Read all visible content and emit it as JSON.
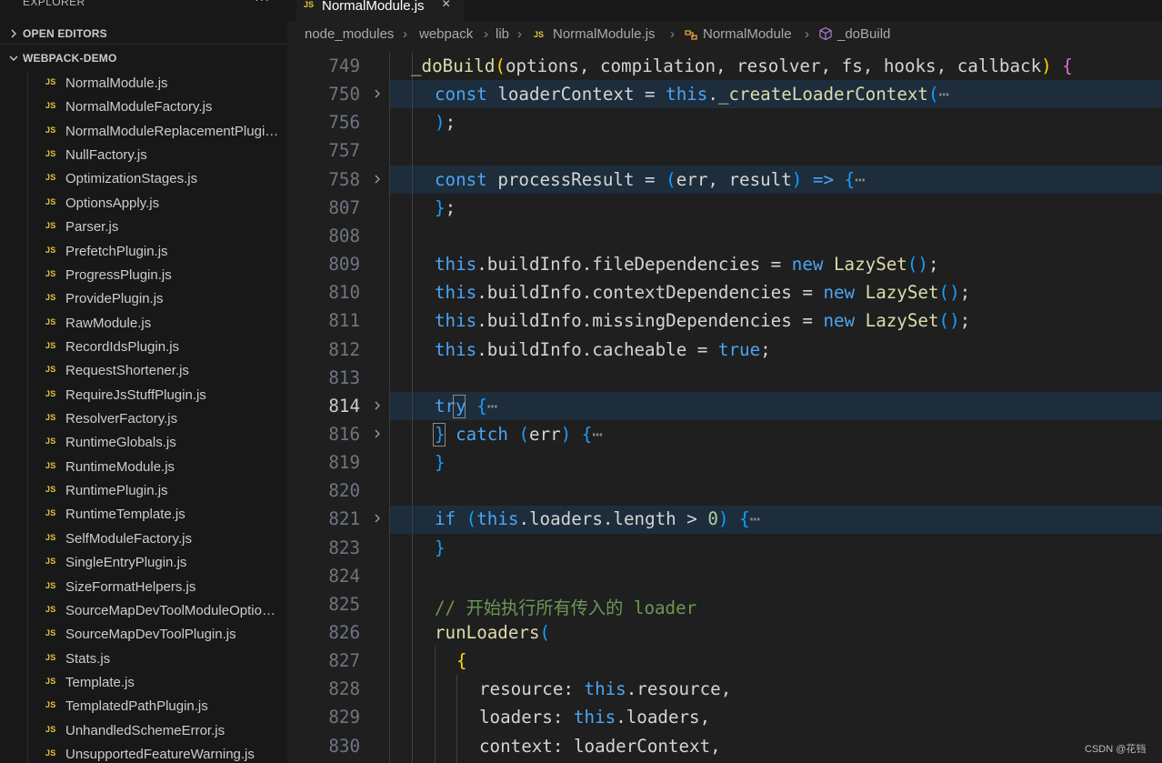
{
  "sidebar": {
    "explorer_title": "EXPLORER",
    "more": "···",
    "open_editors": "OPEN EDITORS",
    "project": "WEBPACK-DEMO",
    "file_icon_label": "JS",
    "files": [
      "NormalModule.js",
      "NormalModuleFactory.js",
      "NormalModuleReplacementPlugin.js",
      "NullFactory.js",
      "OptimizationStages.js",
      "OptionsApply.js",
      "Parser.js",
      "PrefetchPlugin.js",
      "ProgressPlugin.js",
      "ProvidePlugin.js",
      "RawModule.js",
      "RecordIdsPlugin.js",
      "RequestShortener.js",
      "RequireJsStuffPlugin.js",
      "ResolverFactory.js",
      "RuntimeGlobals.js",
      "RuntimeModule.js",
      "RuntimePlugin.js",
      "RuntimeTemplate.js",
      "SelfModuleFactory.js",
      "SingleEntryPlugin.js",
      "SizeFormatHelpers.js",
      "SourceMapDevToolModuleOptionsPlugin.js",
      "SourceMapDevToolPlugin.js",
      "Stats.js",
      "Template.js",
      "TemplatedPathPlugin.js",
      "UnhandledSchemeError.js",
      "UnsupportedFeatureWarning.js"
    ]
  },
  "editor": {
    "tab": {
      "icon": "JS",
      "name": "NormalModule.js",
      "close": "×"
    },
    "breadcrumb": [
      "node_modules",
      "webpack",
      "lib",
      "NormalModule.js",
      "NormalModule",
      "_doBuild"
    ],
    "line_numbers": [
      "749",
      "750",
      "756",
      "757",
      "758",
      "807",
      "808",
      "809",
      "810",
      "811",
      "812",
      "813",
      "814",
      "816",
      "819",
      "820",
      "821",
      "823",
      "824",
      "825",
      "826",
      "827",
      "828",
      "829",
      "830"
    ],
    "code": {
      "l749": [
        "_doBuild",
        "(",
        "options, compilation, resolver, fs, hooks, callback",
        ")",
        " ",
        "{"
      ],
      "l750": [
        "const",
        " loaderContext = ",
        "this",
        ".",
        "_createLoaderContext",
        "(",
        "⋯"
      ],
      "l756": [
        ")",
        ";"
      ],
      "l758": [
        "const",
        " processResult = ",
        "(",
        "err, result",
        ")",
        " => ",
        "{",
        "⋯"
      ],
      "l807": [
        "}",
        ";"
      ],
      "l809": [
        "this",
        ".buildInfo.fileDependencies = ",
        "new",
        " ",
        "LazySet",
        "()",
        ";"
      ],
      "l810": [
        "this",
        ".buildInfo.contextDependencies = ",
        "new",
        " ",
        "LazySet",
        "()",
        ";"
      ],
      "l811": [
        "this",
        ".buildInfo.missingDependencies = ",
        "new",
        " ",
        "LazySet",
        "()",
        ";"
      ],
      "l812": [
        "this",
        ".buildInfo.cacheable = ",
        "true",
        ";"
      ],
      "l814": [
        "try",
        " ",
        "{",
        "⋯"
      ],
      "l816": [
        "}",
        " ",
        "catch",
        " ",
        "(",
        "err",
        ")",
        " ",
        "{",
        "⋯"
      ],
      "l819": [
        "}"
      ],
      "l821": [
        "if",
        " ",
        "(",
        "this",
        ".loaders.length > ",
        "0",
        ")",
        " ",
        "{",
        "⋯"
      ],
      "l823": [
        "}"
      ],
      "l825": [
        "// 开始执行所有传入的 loader"
      ],
      "l826": [
        "runLoaders",
        "("
      ],
      "l827": [
        "{"
      ],
      "l828": [
        "resource: ",
        "this",
        ".resource,"
      ],
      "l829": [
        "loaders: ",
        "this",
        ".loaders,"
      ],
      "l830": [
        "context: loaderContext,"
      ]
    }
  },
  "watermark": "CSDN @花铛",
  "colors": {
    "keyword": "#4aa5f5",
    "function": "#dcdcaa",
    "comment": "#6a9955",
    "bracket_gold": "#ffd700",
    "bracket_violet": "#da70d6",
    "bracket_blue": "#179fff",
    "js_icon": "#e8c33b",
    "line_highlight": "#1d2d3c"
  },
  "icons": {
    "chevron": "chevron-right-icon",
    "chevron_open": "chevron-down-icon",
    "fold": "fold-collapsed-icon",
    "class": "class-icon",
    "method": "method-cube-icon"
  }
}
